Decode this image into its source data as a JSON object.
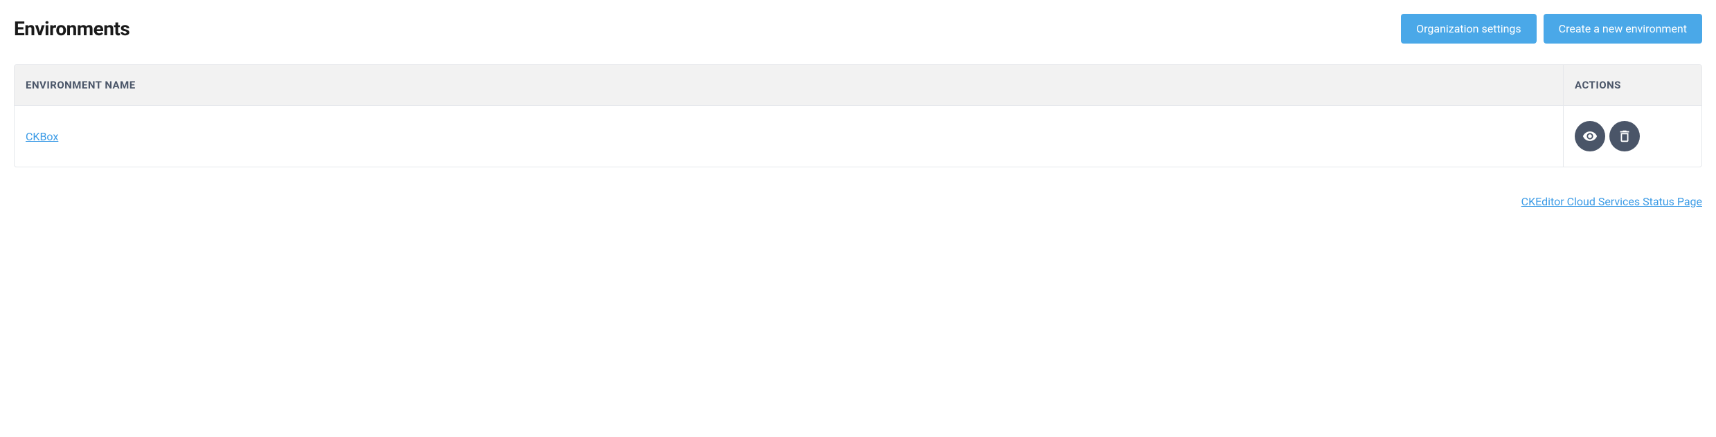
{
  "header": {
    "title": "Environments",
    "buttons": {
      "org_settings": "Organization settings",
      "create_env": "Create a new environment"
    }
  },
  "table": {
    "columns": {
      "name": "ENVIRONMENT NAME",
      "actions": "ACTIONS"
    },
    "rows": [
      {
        "name": "CKBox"
      }
    ]
  },
  "icons": {
    "view": "eye-icon",
    "delete": "trash-icon"
  },
  "footer": {
    "status_link": "CKEditor Cloud Services Status Page"
  },
  "colors": {
    "primary_button": "#4aa8e8",
    "action_button": "#4a5568",
    "link": "#3b9be6",
    "header_bg": "#f2f2f2",
    "border": "#e5e7eb"
  }
}
